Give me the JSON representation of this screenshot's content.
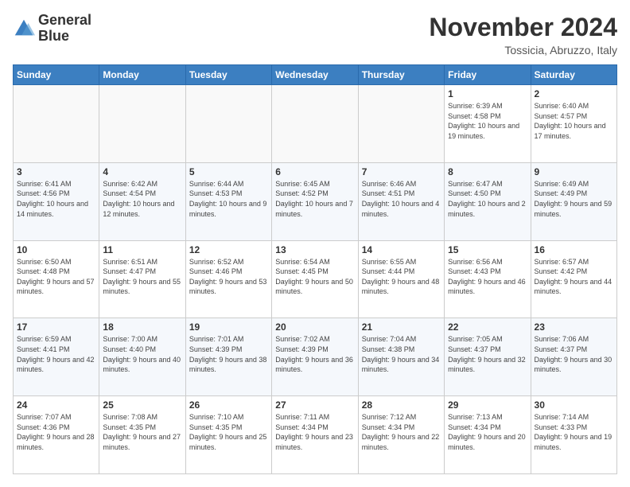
{
  "logo": {
    "line1": "General",
    "line2": "Blue"
  },
  "title": "November 2024",
  "location": "Tossicia, Abruzzo, Italy",
  "days_header": [
    "Sunday",
    "Monday",
    "Tuesday",
    "Wednesday",
    "Thursday",
    "Friday",
    "Saturday"
  ],
  "weeks": [
    [
      {
        "day": "",
        "info": ""
      },
      {
        "day": "",
        "info": ""
      },
      {
        "day": "",
        "info": ""
      },
      {
        "day": "",
        "info": ""
      },
      {
        "day": "",
        "info": ""
      },
      {
        "day": "1",
        "info": "Sunrise: 6:39 AM\nSunset: 4:58 PM\nDaylight: 10 hours and 19 minutes."
      },
      {
        "day": "2",
        "info": "Sunrise: 6:40 AM\nSunset: 4:57 PM\nDaylight: 10 hours and 17 minutes."
      }
    ],
    [
      {
        "day": "3",
        "info": "Sunrise: 6:41 AM\nSunset: 4:56 PM\nDaylight: 10 hours and 14 minutes."
      },
      {
        "day": "4",
        "info": "Sunrise: 6:42 AM\nSunset: 4:54 PM\nDaylight: 10 hours and 12 minutes."
      },
      {
        "day": "5",
        "info": "Sunrise: 6:44 AM\nSunset: 4:53 PM\nDaylight: 10 hours and 9 minutes."
      },
      {
        "day": "6",
        "info": "Sunrise: 6:45 AM\nSunset: 4:52 PM\nDaylight: 10 hours and 7 minutes."
      },
      {
        "day": "7",
        "info": "Sunrise: 6:46 AM\nSunset: 4:51 PM\nDaylight: 10 hours and 4 minutes."
      },
      {
        "day": "8",
        "info": "Sunrise: 6:47 AM\nSunset: 4:50 PM\nDaylight: 10 hours and 2 minutes."
      },
      {
        "day": "9",
        "info": "Sunrise: 6:49 AM\nSunset: 4:49 PM\nDaylight: 9 hours and 59 minutes."
      }
    ],
    [
      {
        "day": "10",
        "info": "Sunrise: 6:50 AM\nSunset: 4:48 PM\nDaylight: 9 hours and 57 minutes."
      },
      {
        "day": "11",
        "info": "Sunrise: 6:51 AM\nSunset: 4:47 PM\nDaylight: 9 hours and 55 minutes."
      },
      {
        "day": "12",
        "info": "Sunrise: 6:52 AM\nSunset: 4:46 PM\nDaylight: 9 hours and 53 minutes."
      },
      {
        "day": "13",
        "info": "Sunrise: 6:54 AM\nSunset: 4:45 PM\nDaylight: 9 hours and 50 minutes."
      },
      {
        "day": "14",
        "info": "Sunrise: 6:55 AM\nSunset: 4:44 PM\nDaylight: 9 hours and 48 minutes."
      },
      {
        "day": "15",
        "info": "Sunrise: 6:56 AM\nSunset: 4:43 PM\nDaylight: 9 hours and 46 minutes."
      },
      {
        "day": "16",
        "info": "Sunrise: 6:57 AM\nSunset: 4:42 PM\nDaylight: 9 hours and 44 minutes."
      }
    ],
    [
      {
        "day": "17",
        "info": "Sunrise: 6:59 AM\nSunset: 4:41 PM\nDaylight: 9 hours and 42 minutes."
      },
      {
        "day": "18",
        "info": "Sunrise: 7:00 AM\nSunset: 4:40 PM\nDaylight: 9 hours and 40 minutes."
      },
      {
        "day": "19",
        "info": "Sunrise: 7:01 AM\nSunset: 4:39 PM\nDaylight: 9 hours and 38 minutes."
      },
      {
        "day": "20",
        "info": "Sunrise: 7:02 AM\nSunset: 4:39 PM\nDaylight: 9 hours and 36 minutes."
      },
      {
        "day": "21",
        "info": "Sunrise: 7:04 AM\nSunset: 4:38 PM\nDaylight: 9 hours and 34 minutes."
      },
      {
        "day": "22",
        "info": "Sunrise: 7:05 AM\nSunset: 4:37 PM\nDaylight: 9 hours and 32 minutes."
      },
      {
        "day": "23",
        "info": "Sunrise: 7:06 AM\nSunset: 4:37 PM\nDaylight: 9 hours and 30 minutes."
      }
    ],
    [
      {
        "day": "24",
        "info": "Sunrise: 7:07 AM\nSunset: 4:36 PM\nDaylight: 9 hours and 28 minutes."
      },
      {
        "day": "25",
        "info": "Sunrise: 7:08 AM\nSunset: 4:35 PM\nDaylight: 9 hours and 27 minutes."
      },
      {
        "day": "26",
        "info": "Sunrise: 7:10 AM\nSunset: 4:35 PM\nDaylight: 9 hours and 25 minutes."
      },
      {
        "day": "27",
        "info": "Sunrise: 7:11 AM\nSunset: 4:34 PM\nDaylight: 9 hours and 23 minutes."
      },
      {
        "day": "28",
        "info": "Sunrise: 7:12 AM\nSunset: 4:34 PM\nDaylight: 9 hours and 22 minutes."
      },
      {
        "day": "29",
        "info": "Sunrise: 7:13 AM\nSunset: 4:34 PM\nDaylight: 9 hours and 20 minutes."
      },
      {
        "day": "30",
        "info": "Sunrise: 7:14 AM\nSunset: 4:33 PM\nDaylight: 9 hours and 19 minutes."
      }
    ]
  ]
}
